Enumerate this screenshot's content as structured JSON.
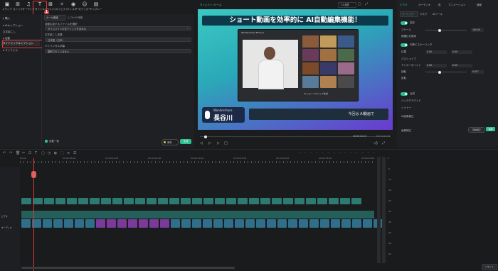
{
  "toolbar": {
    "items": [
      {
        "icon": "media-icon",
        "glyph": "▣",
        "label": "メディア"
      },
      {
        "icon": "stock-icon",
        "glyph": "⊞",
        "label": "ストック"
      },
      {
        "icon": "audio-icon",
        "glyph": "♫",
        "label": "オーディオ"
      },
      {
        "icon": "title-icon",
        "glyph": "T",
        "label": "タイトル"
      },
      {
        "icon": "transition-icon",
        "glyph": "⊠",
        "label": "トランジション"
      },
      {
        "icon": "effect-icon",
        "glyph": "✧",
        "label": "エフェクト"
      },
      {
        "icon": "filter-icon",
        "glyph": "◉",
        "label": "フィルター"
      },
      {
        "icon": "sticker-icon",
        "glyph": "☺",
        "label": "ステッカー"
      },
      {
        "icon": "template-icon",
        "glyph": "▤",
        "label": "テンプレート"
      }
    ],
    "badge1": "1",
    "badge2": "2"
  },
  "sidebar": {
    "items": [
      "▸ 購入",
      "▸ AIキャプション",
      "文字起こし",
      "▸ 自動",
      "ダイナミックキャプション",
      "▸ マイフォル"
    ]
  },
  "settings": {
    "tabs": [
      "ルール設定",
      "レコード作成"
    ],
    "source_label": "自動生成するファイルを選択",
    "source_value": "タイムラインの全クリップを含める",
    "lang_label": "文字起こし言語",
    "lang_value": "日本語（日本）",
    "bilingual_label": "バイリンガル字幕",
    "bilingual_value": "翻訳されていません",
    "auto_match_label": "自動一致",
    "credits": "無料",
    "generate_btn": "生成"
  },
  "player": {
    "tabs": [
      "タイムライン",
      "ソース"
    ],
    "quality": "フル品質",
    "time_current": "00:00:02:03",
    "time_total": "00:01:01:02",
    "banner_text": "ショート動画を効率的に AI自動編集機能！",
    "name_brand": "Wondershare",
    "name_text": "長谷川",
    "subtitle_text": "今回は AI動画で",
    "inner_title": "Wondershare Filmora",
    "screen_caption": "AI ショートクリップ生成"
  },
  "right_panel": {
    "tabs": [
      "ビデオ",
      "オーディオ",
      "色",
      "アニメーション",
      "速度"
    ],
    "subtabs": [
      "ベーシック",
      "マスク",
      "AIツール"
    ],
    "sections": [
      {
        "label": "変形",
        "type": "toggle"
      },
      {
        "label": "スケール",
        "value": "100.00",
        "unit": "%"
      },
      {
        "label": "縦横比を維持",
        "type": "check"
      },
      {
        "label": "均等にスケーリング",
        "type": "toggle"
      },
      {
        "label": "位置",
        "x": "0.00",
        "y": "0.00"
      },
      {
        "label": "パスシェイプ"
      },
      {
        "label": "アンカーポイント",
        "x": "0.00",
        "y": "0.00"
      },
      {
        "label": "回転",
        "value": "0.00°"
      },
      {
        "label": "反転"
      },
      {
        "label": "合成",
        "type": "toggle"
      },
      {
        "label": "バックグラウンド"
      },
      {
        "label": "シャドー"
      },
      {
        "label": "AI画像補正"
      },
      {
        "label": "画像補正"
      },
      {
        "label": "AIプロダクトハイライト",
        "badge": "NEW"
      },
      {
        "label": "モーショントラッキング"
      },
      {
        "label": "平面トラッキング"
      },
      {
        "label": "手ぶれ補正"
      },
      {
        "label": "光学ブラー"
      },
      {
        "label": "動画ノイズ除去"
      },
      {
        "label": "レンズ補正"
      }
    ],
    "auto_btn": "自動補正",
    "apply_btn": "適用",
    "reset_btn": "リセット"
  },
  "timeline": {
    "ruler_labels": [
      "00:00",
      "00:00:05:00",
      "00:00:10:00",
      "00:00:15:00",
      "00:00:20:00",
      "00:00:25:00",
      "00:00:30:00",
      "00:00:35:00",
      "00:00:40:00"
    ],
    "track_labels": [
      "ビデオ",
      "オーディオ"
    ],
    "meter_labels": [
      "0",
      "-6",
      "-12",
      "-18",
      "-24",
      "-30",
      "-36",
      "-42",
      "-48",
      "-54"
    ]
  },
  "colors": {
    "accent": "#2fbf8f",
    "highlight": "#e03a3a",
    "clip": "#2c7a72",
    "banner_bg": "#3cc5d0"
  }
}
